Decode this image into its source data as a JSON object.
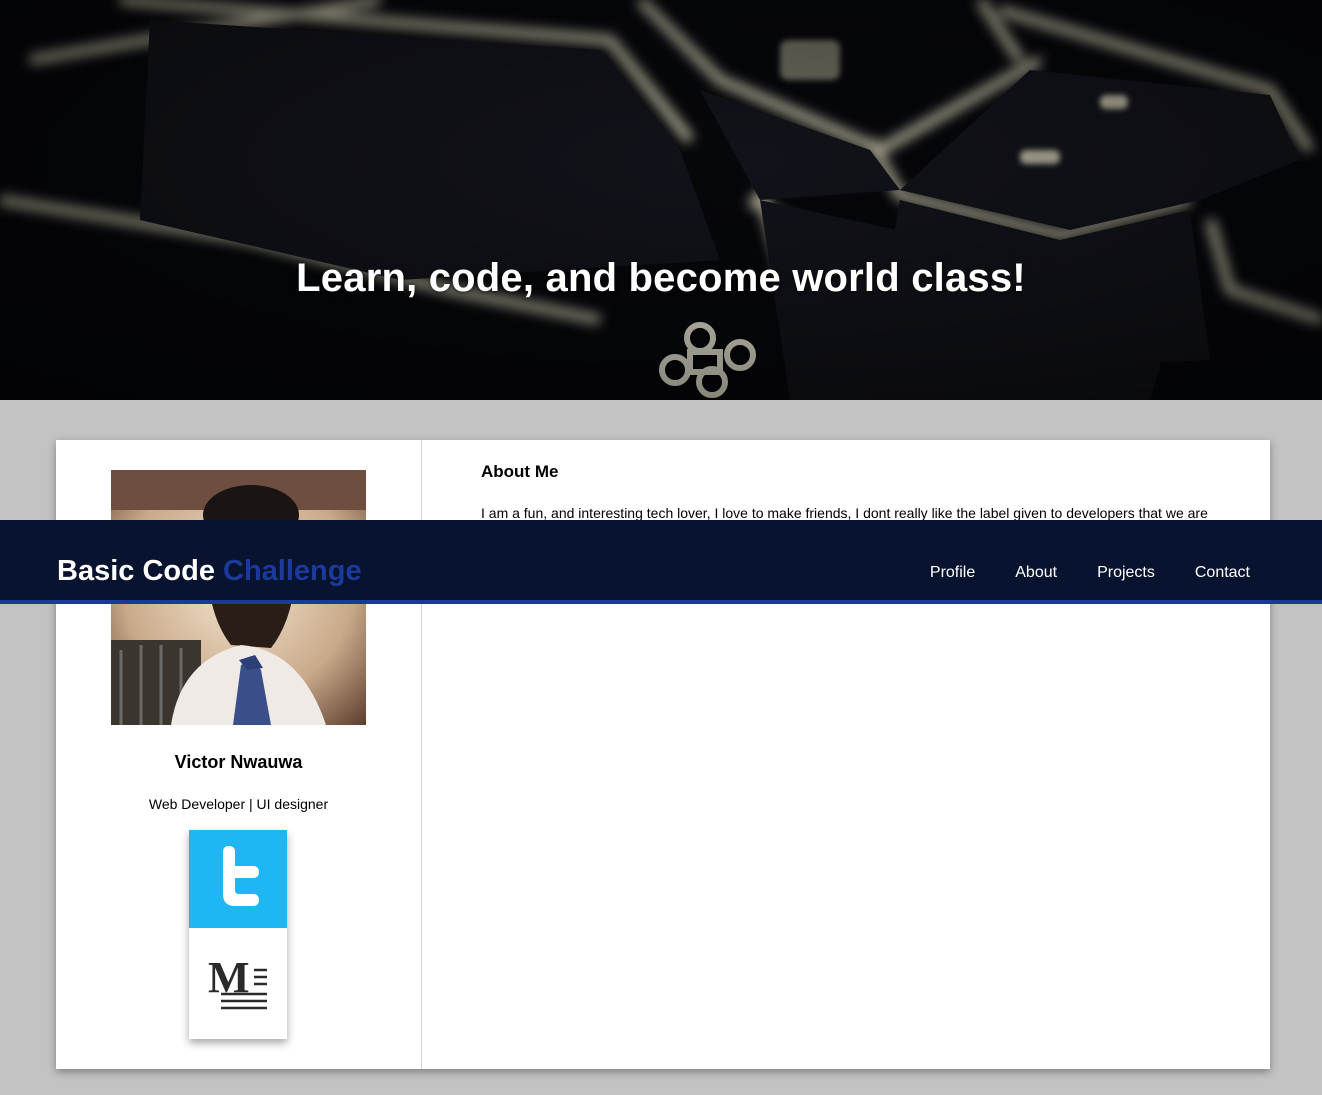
{
  "hero": {
    "title": "Learn, code, and become world class!"
  },
  "navbar": {
    "brand_primary": "Basic Code",
    "brand_accent": "Challenge",
    "links": [
      "Profile",
      "About",
      "Projects",
      "Contact"
    ]
  },
  "profile": {
    "name": "Victor Nwauwa",
    "role": "Web Developer | UI designer",
    "social": [
      {
        "icon": "twitter-icon",
        "color": "#1fb6f5"
      },
      {
        "icon": "medium-icon",
        "color": "#ffffff"
      }
    ]
  },
  "about": {
    "title": "About Me",
    "text": "I am a fun, and interesting tech lover, I love to make friends, I dont really like the label given to developers that we are"
  },
  "colors": {
    "navbar_bg": "#07132f",
    "brand_accent": "#1c3a9e",
    "page_bg": "#c3c3c3"
  }
}
